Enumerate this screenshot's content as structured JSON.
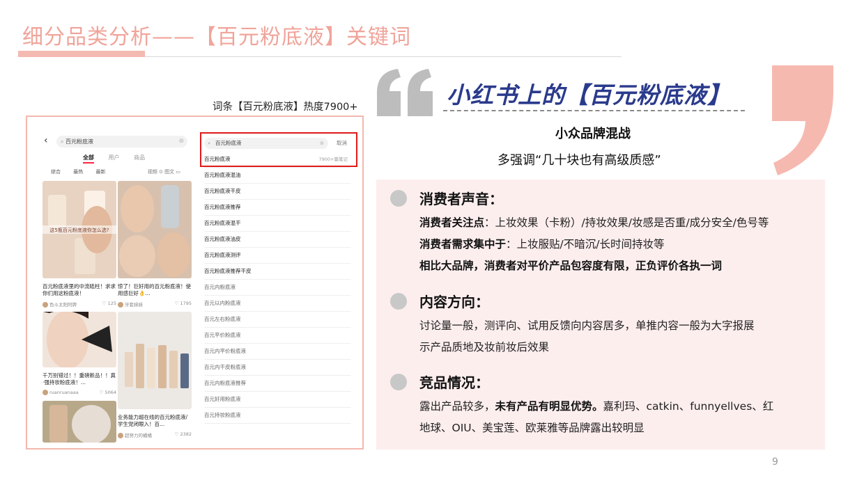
{
  "slide": {
    "title": "细分品类分析——【百元粉底液】关键词",
    "caption": "词条【百元粉底液】热度7900+",
    "page_number": "9",
    "accent_color": "#f0a49a"
  },
  "app": {
    "back_icon": "chevron-left-icon",
    "search_query": "百元粉底液",
    "tabs": [
      "全部",
      "用户",
      "商品"
    ],
    "filters": [
      "综合",
      "最热",
      "最新"
    ],
    "filter_right": "视频 ⊙   图文 ▭",
    "cards": [
      {
        "text": "百元粉底液里的中流砥柱！求求你们用这粉底液！",
        "author": "色斗太阳阿牌",
        "likes": "125",
        "overlay": "这5瓶百元粉底液你怎么选?"
      },
      {
        "text": "惊了！巨好用的百元粉底液！使用感巨好👌...",
        "author": "牙套妹妹",
        "likes": "1795"
      },
      {
        "text": "千万别错过！！重磅新品！！真·强持妆粉底液！...",
        "author": "ruanruanaaa",
        "likes": "5064"
      },
      {
        "text": "业务能力超在线的百元粉底液/学生党闭眼入！百...",
        "author": "超努力的橘橘",
        "likes": "2382"
      }
    ],
    "suggest_search": "百元粉底液",
    "cancel_label": "取消",
    "suggestions": [
      {
        "label": "百元粉底液",
        "hot": "7900+篇笔记"
      },
      {
        "label": "百元粉底液混油"
      },
      {
        "label": "百元粉底液干皮"
      },
      {
        "label": "百元粉底液推荐"
      },
      {
        "label": "百元粉底液混干"
      },
      {
        "label": "百元粉底液油皮"
      },
      {
        "label": "百元粉底液测评"
      },
      {
        "label": "百元粉底液推荐干皮"
      },
      {
        "label": "百元内粉底液"
      },
      {
        "label": "百元以内粉底液"
      },
      {
        "label": "百元左右粉底液"
      },
      {
        "label": "百元平价粉底液"
      },
      {
        "label": "百元内平价粉底液"
      },
      {
        "label": "百元内干皮粉底液"
      },
      {
        "label": "百元内粉底液推荐"
      },
      {
        "label": "百元好用粉底液"
      },
      {
        "label": "百元持妆粉底液"
      }
    ]
  },
  "summary": {
    "headline": "小红书上的【百元粉底液】",
    "sub1": "小众品牌混战",
    "sub2": "多强调“几十块也有高级质感”",
    "sections": [
      {
        "title": "消费者声音：",
        "lines": [
          {
            "bold": "消费者关注点",
            "text": "：上妆效果（卡粉）/持妆效果/妆感是否重/成分安全/色号等"
          },
          {
            "bold": "消费者需求集中于",
            "text": "：上妆服贴/不暗沉/长时间持妆等"
          },
          {
            "bold": "相比大品牌，消费者对平价产品包容度有限，正负评价各执一词",
            "text": ""
          }
        ]
      },
      {
        "title": "内容方向：",
        "lines": [
          {
            "text": "讨论量一般，测评向、试用反馈向内容居多，单推内容一般为大字报展"
          },
          {
            "text": "示产品质地及妆前妆后效果"
          }
        ]
      },
      {
        "title": "竞品情况：",
        "lines": [
          {
            "pre": "露出产品较多，",
            "bold": "未有产品有明显优势。",
            "text": "嘉利玛、catkin、funnyellves、红"
          },
          {
            "text": "地球、OIU、美宝莲、欧莱雅等品牌露出较明显"
          }
        ]
      }
    ]
  }
}
